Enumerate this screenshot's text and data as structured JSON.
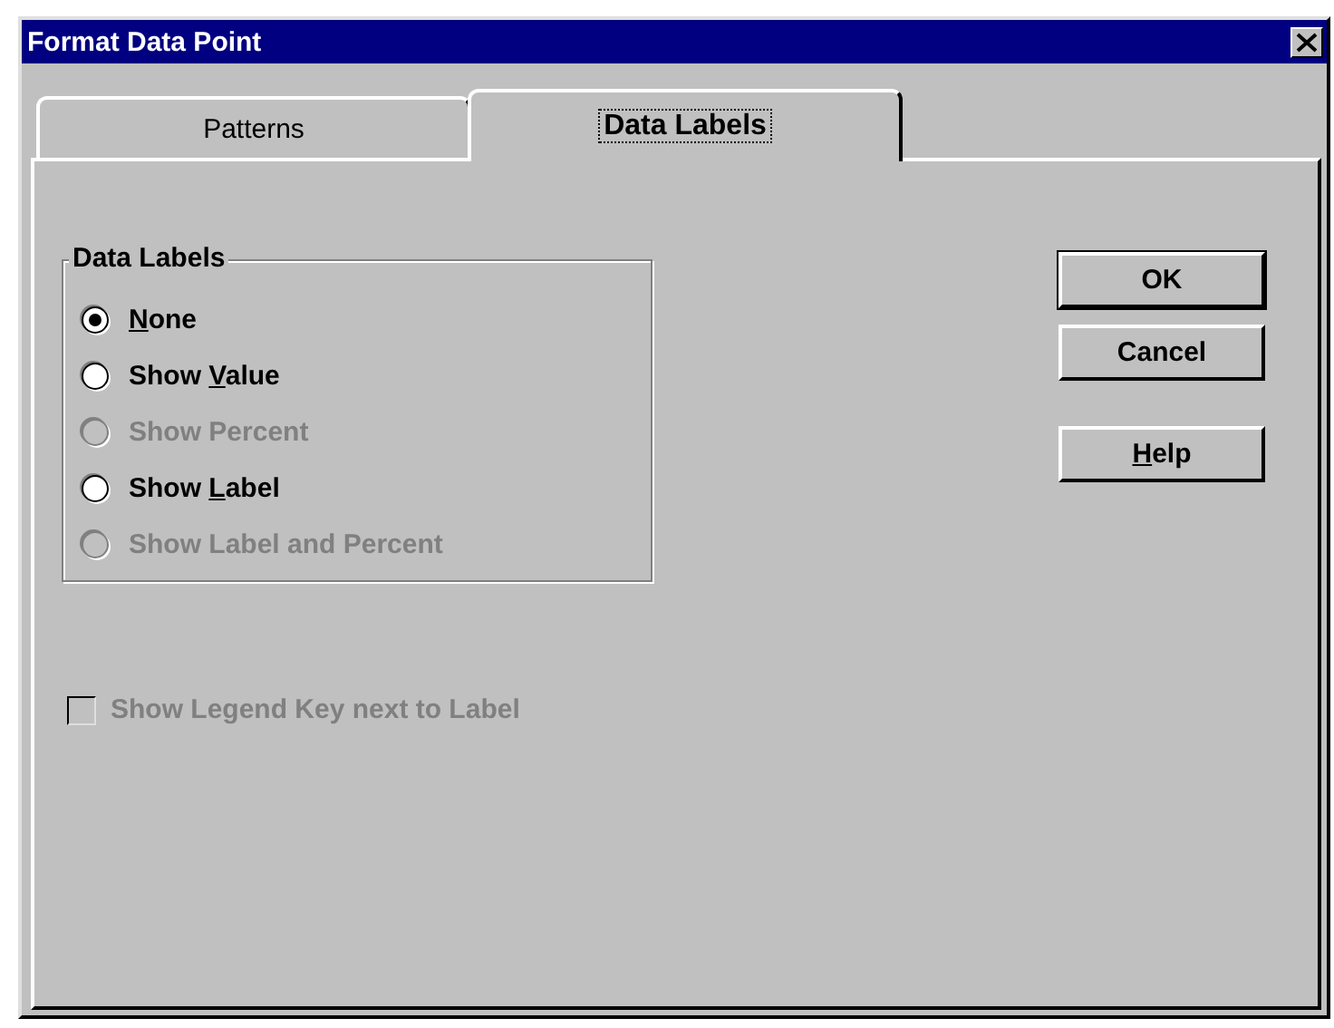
{
  "window": {
    "title": "Format Data Point"
  },
  "tabs": [
    {
      "label": "Patterns",
      "selected": false
    },
    {
      "label": "Data Labels",
      "selected": true
    }
  ],
  "group": {
    "title": "Data Labels",
    "options": [
      {
        "label": [
          {
            "text": "N",
            "underlined": true
          },
          {
            "text": "one",
            "underlined": false
          }
        ],
        "selected": true,
        "disabled": false
      },
      {
        "label": [
          {
            "text": "Show ",
            "underlined": false
          },
          {
            "text": "V",
            "underlined": true
          },
          {
            "text": "alue",
            "underlined": false
          }
        ],
        "selected": false,
        "disabled": false
      },
      {
        "label": [
          {
            "text": "Show Percent",
            "underlined": false
          }
        ],
        "selected": false,
        "disabled": true
      },
      {
        "label": [
          {
            "text": "Show ",
            "underlined": false
          },
          {
            "text": "L",
            "underlined": true
          },
          {
            "text": "abel",
            "underlined": false
          }
        ],
        "selected": false,
        "disabled": false
      },
      {
        "label": [
          {
            "text": "Show Label and Percent",
            "underlined": false
          }
        ],
        "selected": false,
        "disabled": true
      }
    ]
  },
  "checkbox": {
    "label": "Show Legend Key next to Label",
    "checked": false,
    "disabled": true
  },
  "buttons": [
    {
      "label": [
        {
          "text": "OK",
          "underlined": false
        }
      ],
      "default": true
    },
    {
      "label": [
        {
          "text": "Cancel",
          "underlined": false
        }
      ],
      "default": false
    },
    {
      "label": [
        {
          "text": "H",
          "underlined": true
        },
        {
          "text": "elp",
          "underlined": false
        }
      ],
      "default": false
    }
  ]
}
